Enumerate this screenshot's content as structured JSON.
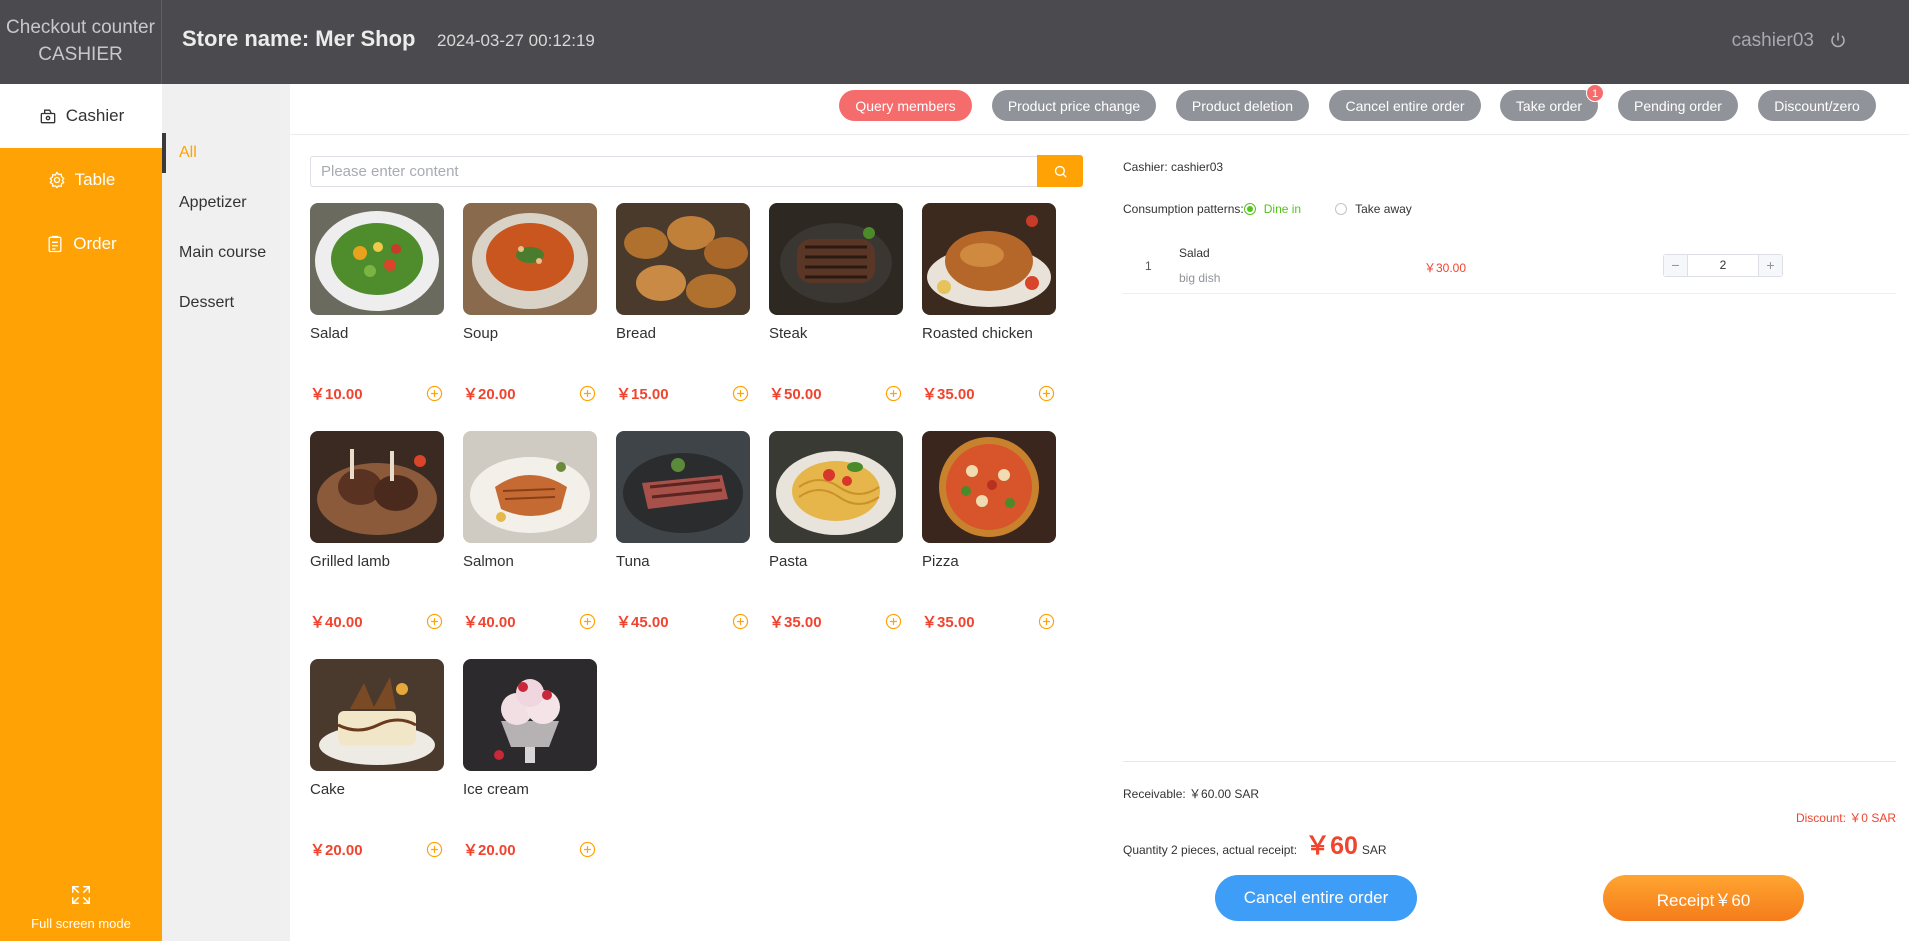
{
  "header": {
    "brand_line1": "Checkout counter",
    "brand_line2": "CASHIER",
    "store": "Store name: Mer Shop",
    "datetime": "2024-03-27 00:12:19",
    "user": "cashier03",
    "power_icon": "power-icon"
  },
  "nav": {
    "items": [
      {
        "label": "Cashier",
        "icon": "cashier-icon",
        "active": true
      },
      {
        "label": "Table",
        "icon": "table-icon",
        "active": false
      },
      {
        "label": "Order",
        "icon": "order-icon",
        "active": false
      }
    ],
    "fullscreen": "Full screen mode"
  },
  "categories": [
    "All",
    "Appetizer",
    "Main course",
    "Dessert"
  ],
  "active_category": "All",
  "toolbar": {
    "query_members": "Query members",
    "price_change": "Product price change",
    "deletion": "Product deletion",
    "cancel_order": "Cancel entire order",
    "take_order": "Take order",
    "take_order_badge": "1",
    "pending": "Pending order",
    "discount": "Discount/zero"
  },
  "search": {
    "placeholder": "Please enter content",
    "value": ""
  },
  "products": [
    {
      "name": "Salad",
      "price": "￥10.00"
    },
    {
      "name": "Soup",
      "price": "￥20.00"
    },
    {
      "name": "Bread",
      "price": "￥15.00"
    },
    {
      "name": "Steak",
      "price": "￥50.00"
    },
    {
      "name": "Roasted chicken",
      "price": "￥35.00"
    },
    {
      "name": "Grilled lamb",
      "price": "￥40.00"
    },
    {
      "name": "Salmon",
      "price": "￥40.00"
    },
    {
      "name": "Tuna",
      "price": "￥45.00"
    },
    {
      "name": "Pasta",
      "price": "￥35.00"
    },
    {
      "name": "Pizza",
      "price": "￥35.00"
    },
    {
      "name": "Cake",
      "price": "￥20.00"
    },
    {
      "name": "Ice cream",
      "price": "￥20.00"
    }
  ],
  "order": {
    "cashier": "Cashier: cashier03",
    "patterns_label": "Consumption patterns:",
    "dine_in": "Dine in",
    "take_away": "Take away",
    "items": [
      {
        "index": "1",
        "name": "Salad",
        "spec": "big dish",
        "price": "￥30.00",
        "quantity": "2"
      }
    ],
    "receivable": "Receivable: ￥60.00 SAR",
    "discount": "Discount: ￥0 SAR",
    "quantity_label": "Quantity 2 pieces, actual receipt:",
    "actual_amount": "￥60",
    "currency": "SAR",
    "cancel_button": "Cancel entire order",
    "receipt_button": "Receipt￥60"
  },
  "colors": {
    "accent": "#ffa205",
    "header": "#4a4a4f",
    "price": "#f0442f",
    "primary_blue": "#3d9df7"
  }
}
